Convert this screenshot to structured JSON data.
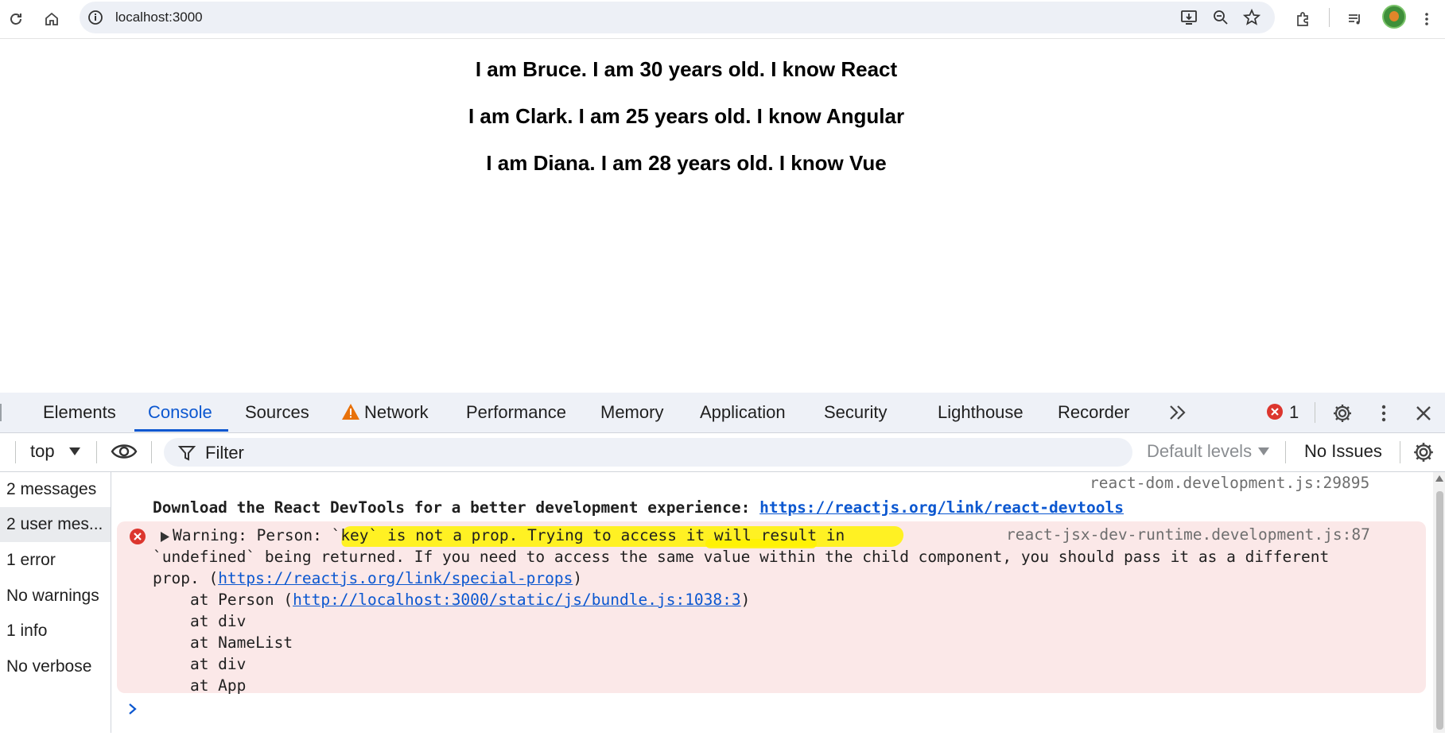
{
  "browser": {
    "url": "localhost:3000"
  },
  "page": {
    "lines": [
      "I am Bruce. I am 30 years old. I know React",
      "I am Clark. I am 25 years old. I know Angular",
      "I am Diana. I am 28 years old. I know Vue"
    ]
  },
  "devtools": {
    "tabs": [
      "Elements",
      "Console",
      "Sources",
      "Network",
      "Performance",
      "Memory",
      "Application",
      "Security",
      "Lighthouse",
      "Recorder"
    ],
    "active_tab": "Console",
    "error_count": "1",
    "filter_bar": {
      "context": "top",
      "filter_placeholder": "Filter",
      "levels": "Default levels",
      "issues": "No Issues"
    },
    "sidebar": [
      "2 messages",
      "2 user mes...",
      "1 error",
      "No warnings",
      "1 info",
      "No verbose"
    ],
    "console": {
      "msg1_source": "react-dom.development.js:29895",
      "msg1_text": "Download the React DevTools for a better development experience: ",
      "msg1_link": "https://reactjs.org/link/react-devtools",
      "err_source": "react-jsx-dev-runtime.development.js:87",
      "err_line1": "Warning: Person: `key` is not a prop. Trying to access it will result in",
      "err_line2": "`undefined` being returned. If you need to access the same value within the child component, you should pass it as a different",
      "err_line3_pre": "prop. (",
      "err_line3_link": "https://reactjs.org/link/special-props",
      "err_line3_post": ")",
      "err_line4_pre": "    at Person (",
      "err_line4_link": "http://localhost:3000/static/js/bundle.js:1038:3",
      "err_line4_post": ")",
      "err_line5": "    at div",
      "err_line6": "    at NameList",
      "err_line7": "    at div",
      "err_line8": "    at App"
    }
  },
  "colors": {
    "accent": "#0b57d0",
    "error_bg": "#fbe8e8",
    "error_red": "#dc362e",
    "highlight": "#fff200",
    "warning_orange": "#e8710a"
  }
}
